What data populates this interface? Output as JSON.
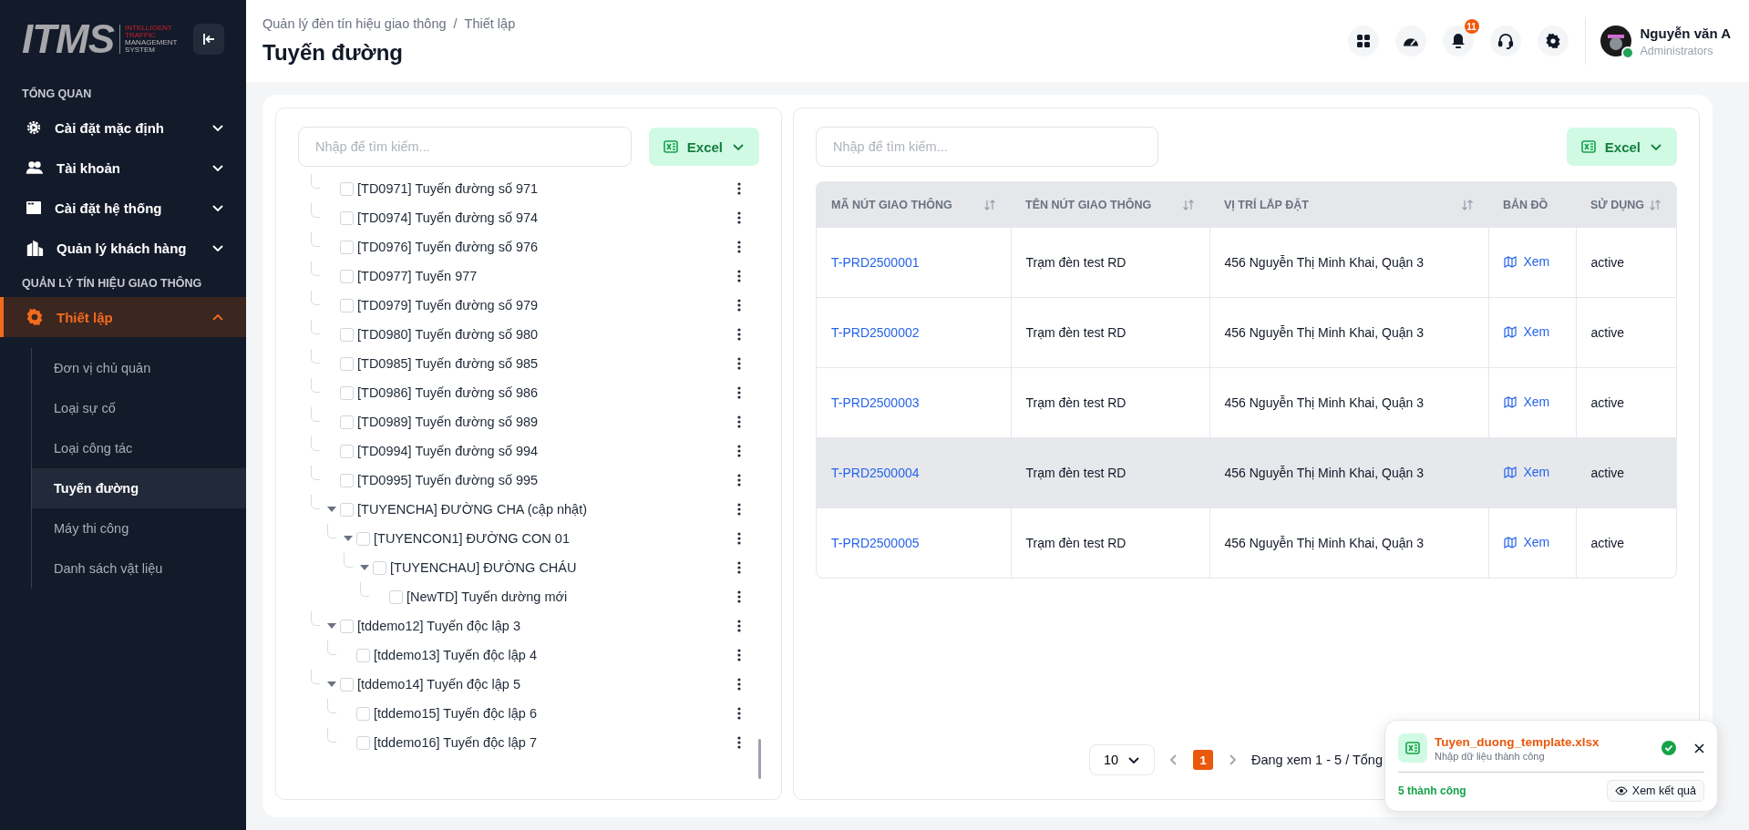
{
  "sidebar": {
    "logo": {
      "mark": "ITMS",
      "lines": [
        "INTELLIGENT",
        "TRAFFIC",
        "MANAGEMENT",
        "SYSTEM"
      ]
    },
    "sections": [
      {
        "title": "TỔNG QUAN",
        "items": [
          {
            "label": "Cài đặt mặc định",
            "expanded": false,
            "selected": false
          },
          {
            "label": "Tài khoản",
            "expanded": false,
            "selected": false
          },
          {
            "label": "Cài đặt hệ thống",
            "expanded": false,
            "selected": false
          },
          {
            "label": "Quản lý khách hàng",
            "expanded": false,
            "selected": false
          }
        ]
      },
      {
        "title": "QUẢN LÝ TÍN HIỆU GIAO THÔNG",
        "items": [
          {
            "label": "Thiết lập",
            "expanded": true,
            "selected": true,
            "children": [
              {
                "label": "Đơn vị chủ quản",
                "selected": false
              },
              {
                "label": "Loại sự cố",
                "selected": false
              },
              {
                "label": "Loại công tác",
                "selected": false
              },
              {
                "label": "Tuyến đường",
                "selected": true
              },
              {
                "label": "Máy thi công",
                "selected": false
              },
              {
                "label": "Danh sách vật liệu",
                "selected": false
              }
            ]
          }
        ]
      }
    ]
  },
  "header": {
    "breadcrumb": [
      "Quản lý đèn tín hiệu giao thông",
      "Thiết lập"
    ],
    "breadcrumb_separator": "/",
    "title": "Tuyến đường",
    "notification_badge": "11",
    "user": {
      "name": "Nguyễn văn A",
      "role": "Administrators",
      "online": true
    }
  },
  "tree_panel": {
    "search": {
      "placeholder": "Nhập để tìm kiếm..."
    },
    "export_button": "Excel",
    "items": [
      {
        "label": "[TD0971] Tuyến đường số 971",
        "checked": false
      },
      {
        "label": "[TD0974] Tuyến đường số 974",
        "checked": false
      },
      {
        "label": "[TD0976] Tuyến đường số 976",
        "checked": false
      },
      {
        "label": "[TD0977] Tuyến 977",
        "checked": false
      },
      {
        "label": "[TD0979] Tuyến đường số 979",
        "checked": false
      },
      {
        "label": "[TD0980] Tuyến đường số 980",
        "checked": false
      },
      {
        "label": "[TD0985] Tuyến đường số 985",
        "checked": false
      },
      {
        "label": "[TD0986] Tuyến đường số 986",
        "checked": false
      },
      {
        "label": "[TD0989] Tuyến đường số 989",
        "checked": false
      },
      {
        "label": "[TD0994] Tuyến đường số 994",
        "checked": false
      },
      {
        "label": "[TD0995] Tuyến đường số 995",
        "checked": false
      },
      {
        "label": "[TUYENCHA] ĐƯỜNG CHA (cập nhật)",
        "checked": false,
        "expanded": true,
        "children": [
          {
            "label": "[TUYENCON1] ĐƯỜNG CON 01",
            "checked": false,
            "expanded": true,
            "children": [
              {
                "label": "[TUYENCHAU] ĐƯỜNG CHÁU",
                "checked": false,
                "expanded": true,
                "children": [
                  {
                    "label": "[NewTD] Tuyến dường mới",
                    "checked": false
                  }
                ]
              }
            ]
          }
        ]
      },
      {
        "label": "[tddemo12] Tuyến độc lập 3",
        "checked": false,
        "expanded": true,
        "children": [
          {
            "label": "[tddemo13] Tuyến độc lập 4",
            "checked": false
          }
        ]
      },
      {
        "label": "[tddemo14] Tuyến độc lập 5",
        "checked": false,
        "expanded": true,
        "children": [
          {
            "label": "[tddemo15] Tuyến độc lập 6",
            "checked": false
          },
          {
            "label": "[tddemo16] Tuyến độc lập 7",
            "checked": false
          }
        ]
      }
    ]
  },
  "table_panel": {
    "search": {
      "placeholder": "Nhập để tìm kiếm..."
    },
    "export_button": "Excel",
    "columns": [
      {
        "label": "MÃ NÚT GIAO THÔNG",
        "sortable": true
      },
      {
        "label": "TÊN NÚT GIAO THÔNG",
        "sortable": true
      },
      {
        "label": "VỊ TRÍ LẮP ĐẶT",
        "sortable": true
      },
      {
        "label": "BẢN ĐỒ",
        "sortable": false
      },
      {
        "label": "SỬ DỤNG",
        "sortable": true
      }
    ],
    "rows": [
      {
        "code": "T-PRD2500001",
        "name": "Trạm đèn test RD",
        "location": "456 Nguyễn Thị Minh Khai, Quận 3",
        "map_link": "Xem",
        "status": "active",
        "selected": false
      },
      {
        "code": "T-PRD2500002",
        "name": "Trạm đèn test RD",
        "location": "456 Nguyễn Thị Minh Khai, Quận 3",
        "map_link": "Xem",
        "status": "active",
        "selected": false
      },
      {
        "code": "T-PRD2500003",
        "name": "Trạm đèn test RD",
        "location": "456 Nguyễn Thị Minh Khai, Quận 3",
        "map_link": "Xem",
        "status": "active",
        "selected": false
      },
      {
        "code": "T-PRD2500004",
        "name": "Trạm đèn test RD",
        "location": "456 Nguyễn Thị Minh Khai, Quận 3",
        "map_link": "Xem",
        "status": "active",
        "selected": true
      },
      {
        "code": "T-PRD2500005",
        "name": "Trạm đèn test RD",
        "location": "456 Nguyễn Thị Minh Khai, Quận 3",
        "map_link": "Xem",
        "status": "active",
        "selected": false
      }
    ],
    "pagination": {
      "page_size": "10",
      "pages": [
        {
          "label": "1",
          "selected": true
        }
      ],
      "summary": "Đang xem 1 - 5 / Tổng"
    }
  },
  "toast": {
    "file_name": "Tuyen_duong_template.xlsx",
    "message": "Nhập dữ liệu thành công",
    "result": "5 thành công",
    "button": "Xem kết quả"
  }
}
